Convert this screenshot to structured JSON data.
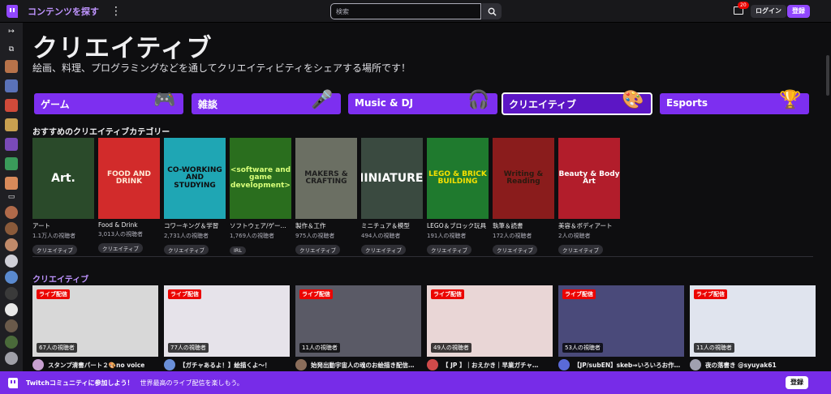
{
  "topbar": {
    "browse_label": "コンテンツを探す",
    "more_icon": "⋮",
    "search_placeholder": "検索",
    "notification_count": "20",
    "login_label": "ログイン",
    "signup_label": "登録"
  },
  "page": {
    "title": "クリエイティブ",
    "subtitle": "絵画、料理、プログラミングなどを通してクリエイティビティをシェアする場所です！"
  },
  "category_tabs": [
    {
      "label": "ゲーム",
      "icon": "gamepad-icon",
      "glyph": "🎮"
    },
    {
      "label": "雑談",
      "icon": "microphone-icon",
      "glyph": "🎤"
    },
    {
      "label": "Music & DJ",
      "icon": "headphones-icon",
      "glyph": "🎧"
    },
    {
      "label": "クリエイティブ",
      "icon": "palette-icon",
      "glyph": "🎨"
    },
    {
      "label": "Esports",
      "icon": "trophy-icon",
      "glyph": "🏆"
    }
  ],
  "recommended": {
    "heading": "おすすめのクリエイティブカテゴリー",
    "items": [
      {
        "cover_text": "Art.",
        "name": "アート",
        "viewers": "1.1万人の視聴者",
        "tag": "クリエイティブ",
        "bg": "#2a4a2a",
        "fg": "#ffffff"
      },
      {
        "cover_text": "FOOD AND DRINK",
        "name": "Food & Drink",
        "viewers": "3,013人の視聴者",
        "tag": "クリエイティブ",
        "bg": "#d22b2b",
        "fg": "#ffe9d6"
      },
      {
        "cover_text": "CO-WORKING AND STUDYING",
        "name": "コワーキング＆学習",
        "viewers": "2,731人の視聴者",
        "tag": "クリエイティブ",
        "bg": "#1fa6b4",
        "fg": "#0e0e10"
      },
      {
        "cover_text": "<software and game development>",
        "name": "ソフトウェア/ゲーム…",
        "viewers": "1,769人の視聴者",
        "tag": "IRL",
        "bg": "#2a6e1e",
        "fg": "#d9ff7a"
      },
      {
        "cover_text": "MAKERS & CRAFTING",
        "name": "製作＆工作",
        "viewers": "975人の視聴者",
        "tag": "クリエイティブ",
        "bg": "#6b6f63",
        "fg": "#1e1e1e"
      },
      {
        "cover_text": "MINIATURES",
        "name": "ミニチュア＆模型",
        "viewers": "494人の視聴者",
        "tag": "クリエイティブ",
        "bg": "#3a4a40",
        "fg": "#ffffff"
      },
      {
        "cover_text": "LEGO & BRICK BUILDING",
        "name": "LEGO＆ブロック玩具",
        "viewers": "191人の視聴者",
        "tag": "クリエイティブ",
        "bg": "#1f7a2e",
        "fg": "#f5e100"
      },
      {
        "cover_text": "Writing & Reading",
        "name": "執筆＆読書",
        "viewers": "172人の視聴者",
        "tag": "クリエイティブ",
        "bg": "#8a1c1c",
        "fg": "#2a1a10"
      },
      {
        "cover_text": "Beauty & Body Art",
        "name": "美容＆ボディアート",
        "viewers": "2人の視聴者",
        "tag": "クリエイティブ",
        "bg": "#b21d2b",
        "fg": "#ffffff"
      }
    ]
  },
  "live_section": {
    "heading": "クリエイティブ",
    "live_label": "ライブ配信",
    "streams": [
      {
        "viewers": "67人の視聴者",
        "title": "スタンプ清書パート２🎨no voice",
        "bg": "#d8d8d8",
        "av": "#c7a0d0"
      },
      {
        "viewers": "77人の視聴者",
        "title": "【ガチャあるよ！】絵描くよ～！",
        "bg": "#e6e3ea",
        "av": "#6a8fd8"
      },
      {
        "viewers": "11人の視聴者",
        "title": "始発出動宇宙人の魂のお絵描き配信…",
        "bg": "#5a5a66",
        "av": "#8a6d5a"
      },
      {
        "viewers": "49人の視聴者",
        "title": "【 JP 】｜おえかき｜早業ガチャ…",
        "bg": "#e9d6d6",
        "av": "#d04a4a"
      },
      {
        "viewers": "53人の視聴者",
        "title": "【JP/subEN】skeb⇒いろいろお作…",
        "bg": "#4a4a7a",
        "av": "#5a6ad8"
      },
      {
        "viewers": "11人の視聴者",
        "title": "夜の落書き @syuyak61",
        "bg": "#e0e4ee",
        "av": "#a0a0b0"
      }
    ]
  },
  "banner": {
    "strong": "Twitchコミュニティに参加しよう！",
    "text": "世界最高のライブ配信を楽しもう。",
    "button": "登録"
  }
}
